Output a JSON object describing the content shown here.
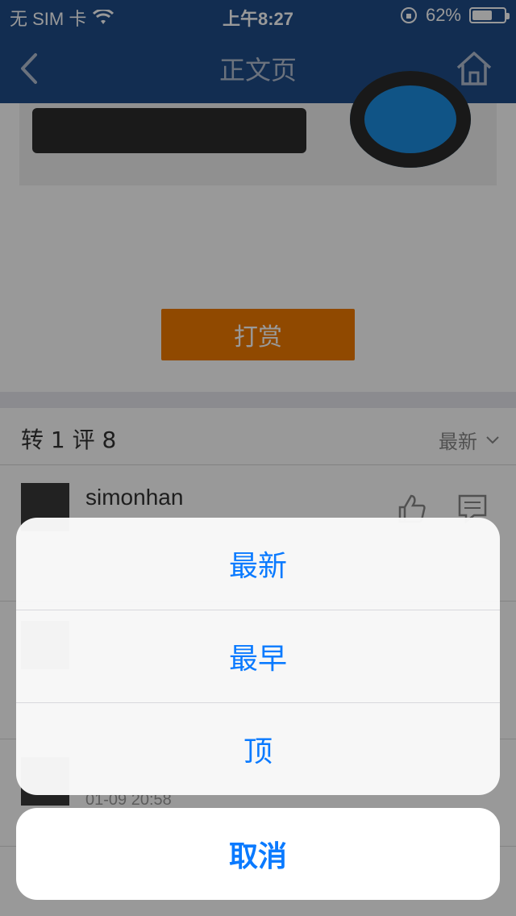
{
  "status_bar": {
    "carrier": "无 SIM 卡",
    "time": "上午8:27",
    "battery_percent": "62%",
    "battery_level": 0.62
  },
  "nav": {
    "title": "正文页",
    "back_icon": "chevron-left-icon",
    "home_icon": "home-icon"
  },
  "article": {
    "reward_label": "打赏"
  },
  "comments_header": {
    "summary": "转 1 评 8",
    "sort_label": "最新"
  },
  "comments": [
    {
      "username": "simonhan",
      "timestamp": ""
    },
    {
      "username": "",
      "timestamp": ""
    },
    {
      "username": "",
      "timestamp": "01-09 20:58"
    }
  ],
  "action_sheet": {
    "options": [
      "最新",
      "最早",
      "顶"
    ],
    "cancel_label": "取消"
  },
  "colors": {
    "nav_bg": "#1f4b87",
    "accent_blue": "#0a7aff",
    "reward_orange": "#f07b00"
  }
}
